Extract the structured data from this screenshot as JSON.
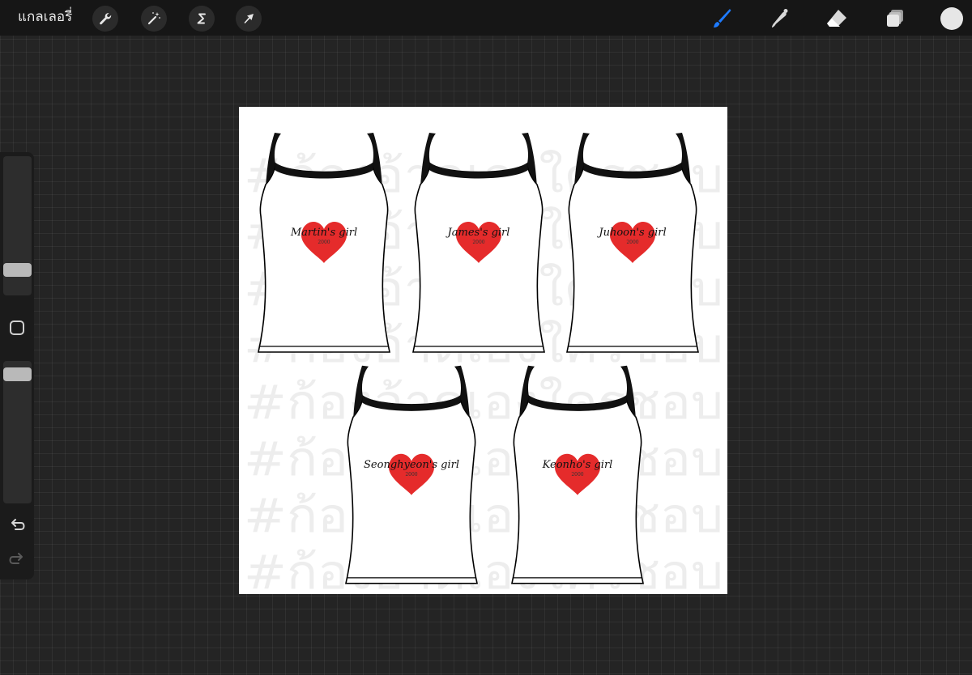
{
  "topbar": {
    "gallery_label": "แกลเลอรี่",
    "actions_icon": "wrench-icon",
    "adjustments_icon": "magic-wand-icon",
    "selection_icon": "selection-s-icon",
    "transform_icon": "arrow-cursor-icon",
    "brush_icon": "brush-icon",
    "smudge_icon": "smudge-icon",
    "eraser_icon": "eraser-icon",
    "layers_icon": "layers-icon",
    "active_tool": "brush",
    "accent_color": "#1e7bff",
    "current_color": "#e6e6e6"
  },
  "sidebar": {
    "brush_size_level": 0.15,
    "opacity_level": 0.95,
    "undo_icon": "undo-icon",
    "redo_icon": "redo-icon"
  },
  "canvas": {
    "watermark_text": "#ก้องอ้าดเองใครชอบ",
    "heart_color": "#e52b2b",
    "year_text": "2000",
    "tops": [
      {
        "label": "Martin's girl"
      },
      {
        "label": "James's girl"
      },
      {
        "label": "Juhoon's girl"
      },
      {
        "label": "Seonghyeon's girl"
      },
      {
        "label": "Keonho's girl"
      }
    ]
  }
}
